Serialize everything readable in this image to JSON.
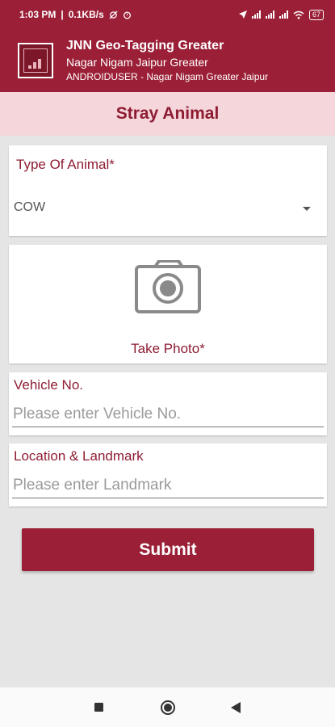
{
  "status_bar": {
    "time": "1:03 PM",
    "network_speed": "0.1KB/s",
    "battery": "67"
  },
  "header": {
    "title": "JNN Geo-Tagging Greater",
    "subtitle": "Nagar Nigam Jaipur Greater",
    "user_line": "ANDROIDUSER - Nagar Nigam Greater Jaipur"
  },
  "page": {
    "title": "Stray Animal"
  },
  "form": {
    "animal_type": {
      "label": "Type Of Animal*",
      "selected": "COW"
    },
    "photo": {
      "label": "Take Photo*"
    },
    "vehicle": {
      "label": "Vehicle No.",
      "placeholder": "Please enter Vehicle No.",
      "value": ""
    },
    "location": {
      "label": "Location & Landmark",
      "placeholder": "Please enter Landmark",
      "value": ""
    },
    "submit_label": "Submit"
  },
  "icons": {
    "camera": "camera-icon",
    "dropdown": "chevron-down-icon",
    "nav_recent": "square-icon",
    "nav_home": "circle-icon",
    "nav_back": "triangle-back-icon"
  },
  "colors": {
    "primary": "#9b2037",
    "title_band": "#f5d6db",
    "background": "#e5e5e5"
  }
}
